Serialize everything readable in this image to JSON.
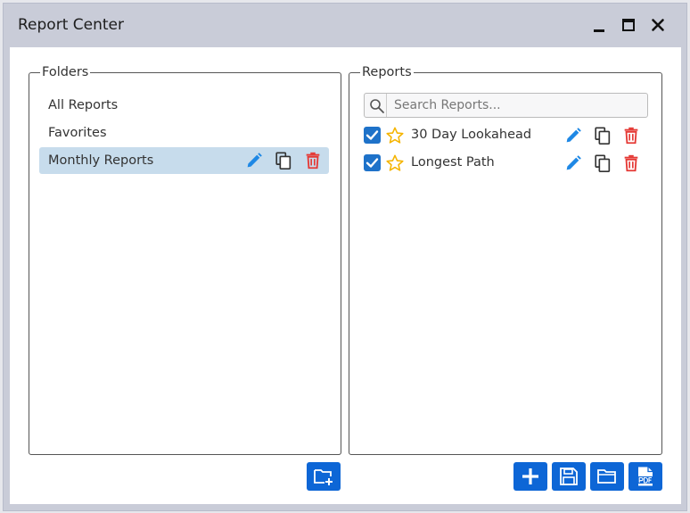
{
  "window": {
    "title": "Report Center",
    "controls": [
      "minimize-icon",
      "maximize-icon",
      "close-icon"
    ]
  },
  "folders": {
    "legend": "Folders",
    "items": [
      {
        "label": "All Reports",
        "selected": false
      },
      {
        "label": "Favorites",
        "selected": false
      },
      {
        "label": "Monthly Reports",
        "selected": true
      }
    ]
  },
  "reports": {
    "legend": "Reports",
    "search": {
      "placeholder": "Search Reports...",
      "value": ""
    },
    "items": [
      {
        "label": "30 Day Lookahead",
        "checked": true,
        "favorite": false
      },
      {
        "label": "Longest Path",
        "checked": true,
        "favorite": false
      }
    ]
  },
  "footer": {
    "folder_actions": [
      "new-folder-icon"
    ],
    "report_actions": [
      "add-icon",
      "save-icon",
      "open-folder-icon",
      "pdf-icon"
    ]
  },
  "colors": {
    "accent_blue": "#0d66d6",
    "edit_blue": "#1e88e5",
    "delete_red": "#e53935",
    "selected_bg": "#c7dcec",
    "star_yellow": "#f5b400",
    "checkbox_blue": "#1e72c9"
  }
}
